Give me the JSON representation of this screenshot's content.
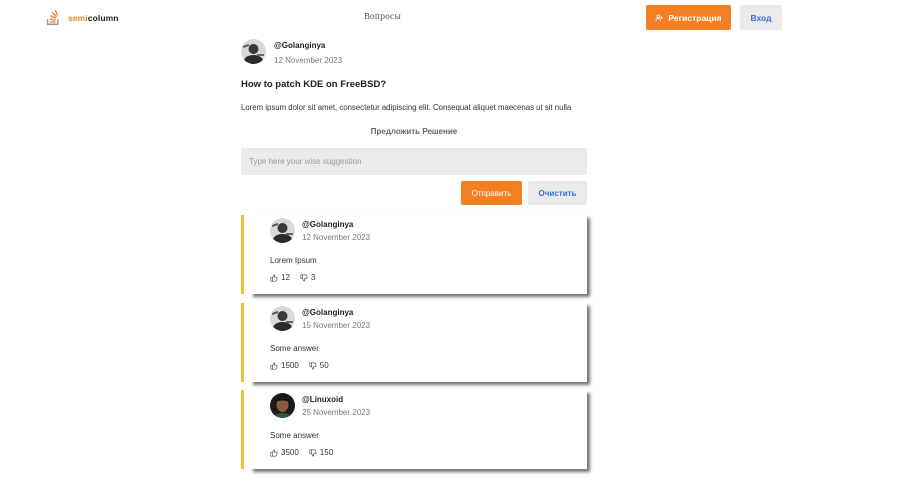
{
  "header": {
    "logo_semi": "semi",
    "logo_column": "column",
    "nav_questions": "Вопросы",
    "register_label": "Регистрация",
    "login_label": "Вход"
  },
  "question": {
    "username": "@Golanginya",
    "date": "12 November 2023",
    "title": "How to patch KDE on FreeBSD?",
    "body": "Lorem ipsum dolor sit amet, consectetur adipiscing elit. Consequat aliquet maecenas ut sit nulla"
  },
  "suggestion": {
    "title": "Предложить Решение",
    "placeholder": "Type here your wise suggestion",
    "send_label": "Отправить",
    "clear_label": "Очистить"
  },
  "answers": [
    {
      "username": "@Golanginya",
      "date": "12 November 2023",
      "body": "Lorem Ipsum",
      "likes": "12",
      "dislikes": "3",
      "avatar": "golanginya"
    },
    {
      "username": "@Golanginya",
      "date": "15 November 2023",
      "body": "Some answer",
      "likes": "1500",
      "dislikes": "50",
      "avatar": "golanginya"
    },
    {
      "username": "@Linuxoid",
      "date": "25 November 2023",
      "body": "Some answer",
      "likes": "3500",
      "dislikes": "150",
      "avatar": "linuxoid"
    }
  ],
  "colors": {
    "accent": "#f48024",
    "answer_border": "#f2c12e",
    "secondary_button_text": "#3a6fd8"
  },
  "icons": {
    "logo": "stack-logo-icon",
    "register": "user-plus-icon",
    "like": "thumbs-up-icon",
    "dislike": "thumbs-down-icon"
  }
}
